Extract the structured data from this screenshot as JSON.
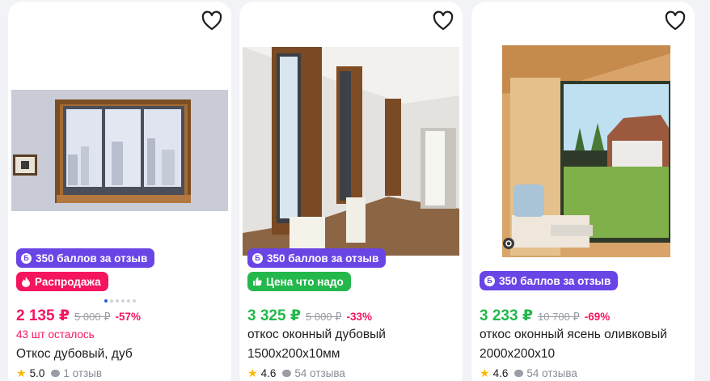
{
  "colors": {
    "accent_sale": "#f5155e",
    "price_green": "#24b84c",
    "points_purple": "#6a45e6"
  },
  "cards": [
    {
      "badges": [
        {
          "icon": "points-b-icon",
          "label": "350 баллов за отзыв"
        },
        {
          "icon": "flame-icon",
          "label": "Распродажа"
        }
      ],
      "price": "2 135 ₽",
      "old_price": "5 000 ₽",
      "discount": "-57%",
      "stock": "43 шт осталось",
      "title": "Откос дубовый, дуб",
      "rating": "5.0",
      "reviews": "1 отзыв"
    },
    {
      "badges": [
        {
          "icon": "points-b-icon",
          "label": "350 баллов за отзыв"
        },
        {
          "icon": "thumbs-up-icon",
          "label": "Цена что надо"
        }
      ],
      "price": "3 325 ₽",
      "old_price": "5 000 ₽",
      "discount": "-33%",
      "title_line1": "откос оконный дубовый",
      "title_line2": "1500x200x10мм",
      "rating": "4.6",
      "reviews": "54 отзыва"
    },
    {
      "badges": [
        {
          "icon": "points-b-icon",
          "label": "350 баллов за отзыв"
        }
      ],
      "price": "3 233 ₽",
      "old_price": "10 700 ₽",
      "discount": "-69%",
      "title_line1": "откос оконный ясень оливковый",
      "title_line2": "2000x200x10",
      "rating": "4.6",
      "reviews": "54 отзыва"
    }
  ]
}
